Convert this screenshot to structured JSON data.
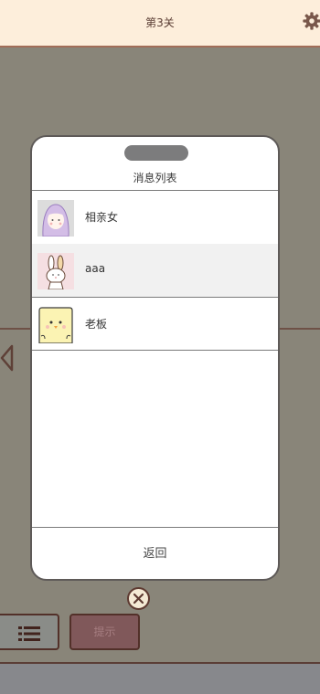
{
  "header": {
    "level_title": "第3关",
    "settings_icon": "gear-icon"
  },
  "message_panel": {
    "title": "消息列表",
    "items": [
      {
        "name": "相亲女",
        "avatar": "girl-avatar",
        "selected": false
      },
      {
        "name": "aaa",
        "avatar": "rabbit-avatar",
        "selected": true
      },
      {
        "name": "老板",
        "avatar": "chick-avatar",
        "selected": false
      }
    ],
    "back_label": "返回"
  },
  "close_icon": "close-circle-icon",
  "toolbar": {
    "menu_icon": "list-icon",
    "hint_label": "提示"
  },
  "colors": {
    "background": "#898579",
    "header_bg": "#fdeedb",
    "panel_bg": "#ffffff",
    "selected_row": "#f1f1f1",
    "hint_button": "#80585a"
  }
}
